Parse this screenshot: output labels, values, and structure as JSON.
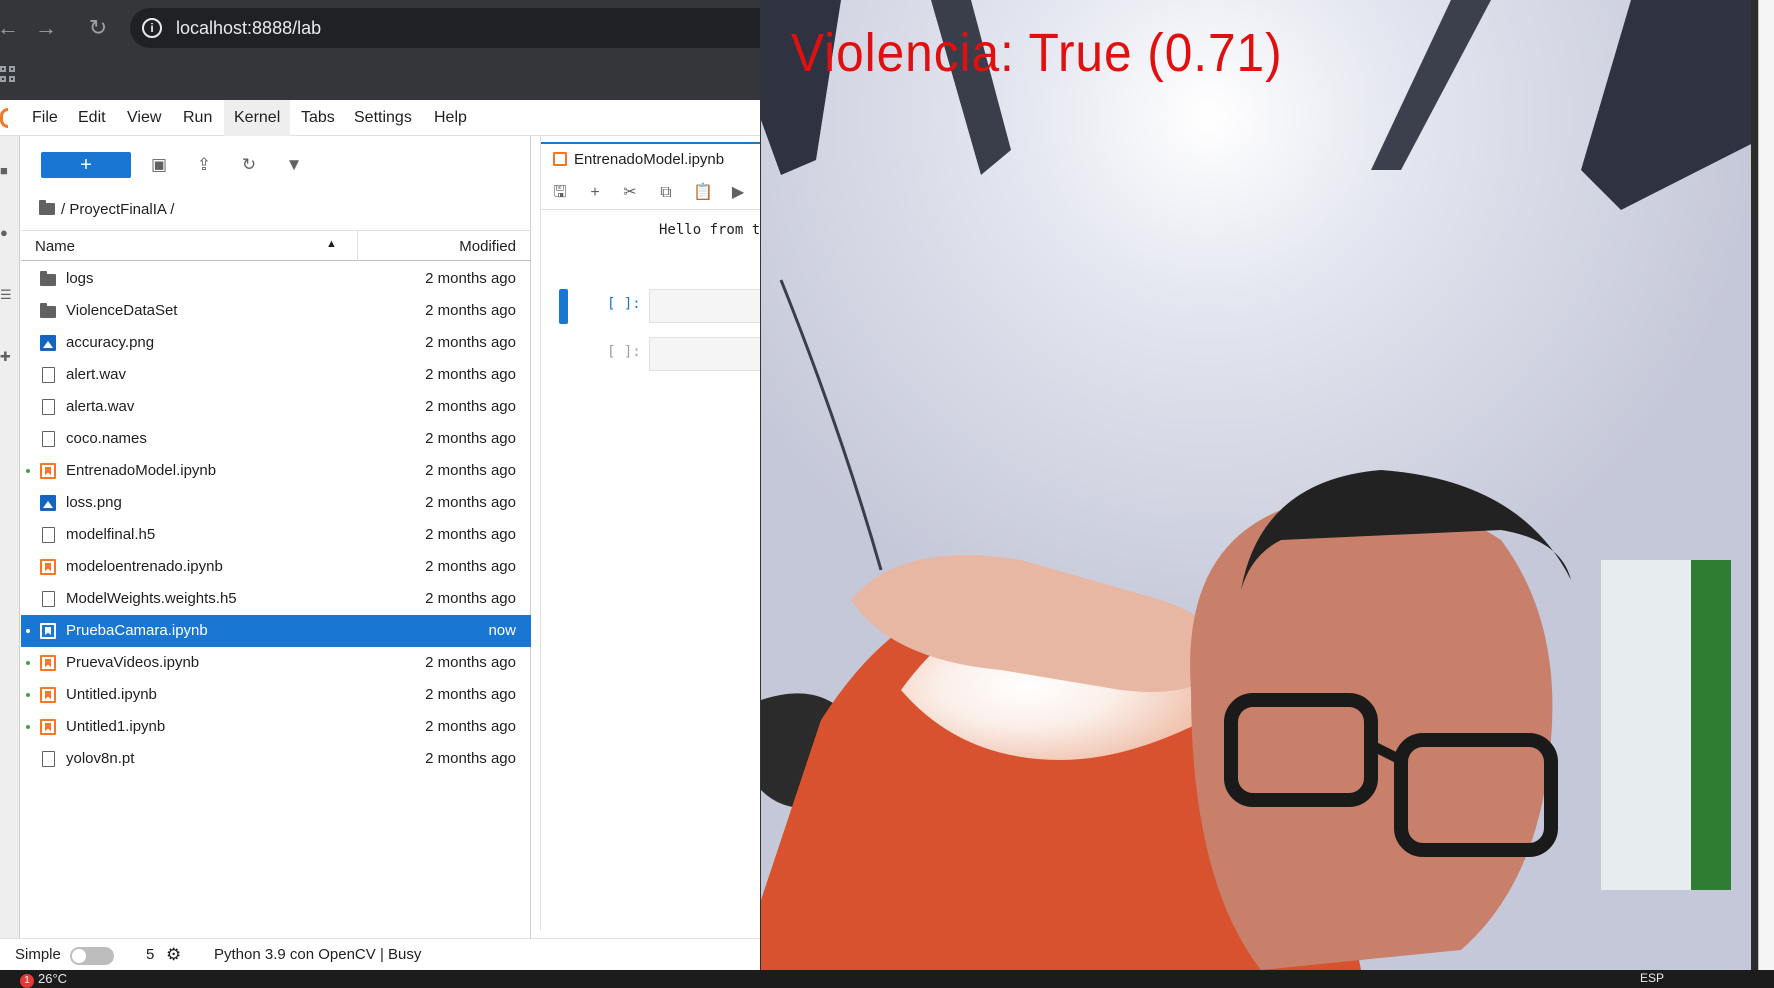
{
  "browser": {
    "url": "localhost:8888/lab",
    "back_icon": "back-arrow-icon",
    "forward_icon": "forward-arrow-icon",
    "reload_icon": "reload-icon"
  },
  "menubar": {
    "items": [
      "File",
      "Edit",
      "View",
      "Run",
      "Kernel",
      "Tabs",
      "Settings",
      "Help"
    ],
    "active": "Kernel"
  },
  "filebrowser": {
    "new_label": "+",
    "breadcrumb": "/ ProyectFinalIA /",
    "header_name": "Name",
    "header_modified": "Modified",
    "files": [
      {
        "name": "logs",
        "modified": "2 months ago",
        "type": "folder",
        "running": false
      },
      {
        "name": "ViolenceDataSet",
        "modified": "2 months ago",
        "type": "folder",
        "running": false
      },
      {
        "name": "accuracy.png",
        "modified": "2 months ago",
        "type": "image",
        "running": false
      },
      {
        "name": "alert.wav",
        "modified": "2 months ago",
        "type": "file",
        "running": false
      },
      {
        "name": "alerta.wav",
        "modified": "2 months ago",
        "type": "file",
        "running": false
      },
      {
        "name": "coco.names",
        "modified": "2 months ago",
        "type": "file",
        "running": false
      },
      {
        "name": "EntrenadoModel.ipynb",
        "modified": "2 months ago",
        "type": "notebook",
        "running": true
      },
      {
        "name": "loss.png",
        "modified": "2 months ago",
        "type": "image",
        "running": false
      },
      {
        "name": "modelfinal.h5",
        "modified": "2 months ago",
        "type": "file",
        "running": false
      },
      {
        "name": "modeloentrenado.ipynb",
        "modified": "2 months ago",
        "type": "notebook",
        "running": false
      },
      {
        "name": "ModelWeights.weights.h5",
        "modified": "2 months ago",
        "type": "file",
        "running": false
      },
      {
        "name": "PruebaCamara.ipynb",
        "modified": "now",
        "type": "notebook",
        "running": true,
        "selected": true
      },
      {
        "name": "PruevaVideos.ipynb",
        "modified": "2 months ago",
        "type": "notebook",
        "running": true
      },
      {
        "name": "Untitled.ipynb",
        "modified": "2 months ago",
        "type": "notebook",
        "running": true
      },
      {
        "name": "Untitled1.ipynb",
        "modified": "2 months ago",
        "type": "notebook",
        "running": true
      },
      {
        "name": "yolov8n.pt",
        "modified": "2 months ago",
        "type": "file",
        "running": false
      }
    ]
  },
  "notebook": {
    "tab_label": "EntrenadoModel.ipynb",
    "output_text": "Hello from t",
    "prompt_active": "[ ]:",
    "prompt_inactive": "[ ]:"
  },
  "statusbar": {
    "simple_label": "Simple",
    "terminal_count": "5",
    "kernel_status": "Python 3.9 con OpenCV | Busy"
  },
  "camera": {
    "overlay_text": "Violencia: True (0.71)"
  },
  "taskbar": {
    "notification_count": "1",
    "temperature": "26°C",
    "language": "ESP"
  },
  "colors": {
    "accent": "#1976d2",
    "notebook_orange": "#f37726",
    "overlay_red": "#e01010",
    "running_dot": "#43a047"
  }
}
